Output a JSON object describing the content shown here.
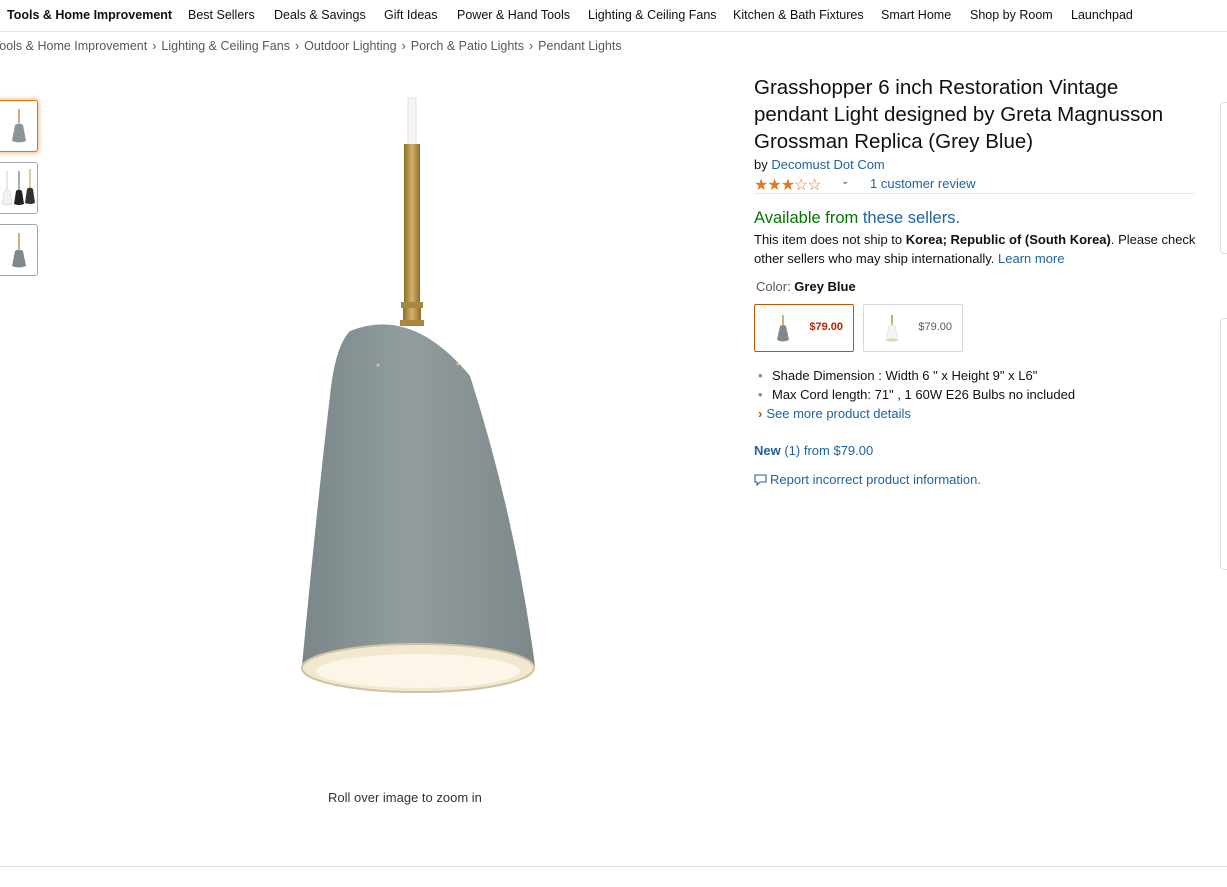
{
  "nav": {
    "items": [
      "Tools & Home Improvement",
      "Best Sellers",
      "Deals & Savings",
      "Gift Ideas",
      "Power & Hand Tools",
      "Lighting & Ceiling Fans",
      "Kitchen & Bath Fixtures",
      "Smart Home",
      "Shop by Room",
      "Launchpad"
    ]
  },
  "breadcrumb": {
    "items": [
      "Tools & Home Improvement",
      "Lighting & Ceiling Fans",
      "Outdoor Lighting",
      "Porch & Patio Lights",
      "Pendant Lights"
    ],
    "separator": "›"
  },
  "gallery": {
    "zoom_hint": "Roll over image to zoom in"
  },
  "product": {
    "title": "Grasshopper 6 inch Restoration Vintage pendant Light designed by Greta Magnusson Grossman Replica (Grey Blue)",
    "by_prefix": "by ",
    "brand": "Decomust Dot Com",
    "rating_stars": 3,
    "rating_max": 5,
    "reviews_text": "1 customer review",
    "availability_prefix": "Available from ",
    "availability_link": "these sellers.",
    "ship_text_1": "This item does not ship to ",
    "ship_country": "Korea; Republic of (South Korea)",
    "ship_text_2": ". Please check other sellers who may ship internationally. ",
    "learn_more": "Learn more",
    "color_label": "Color: ",
    "color_value": "Grey Blue",
    "swatches": [
      {
        "price": "$79.00",
        "selected": true
      },
      {
        "price": "$79.00",
        "selected": false
      }
    ],
    "bullets": [
      "Shade Dimension : Width 6 \" x Height 9\" x L6\"",
      "Max Cord length: 71\" , 1 60W E26 Bulbs no included"
    ],
    "see_more": "See more product details",
    "offers_new": "New",
    "offers_rest": " (1) from $79.00",
    "report": "Report incorrect product information."
  },
  "colors": {
    "star": "#de7921",
    "link": "#2162a1",
    "available": "#007600",
    "price_selected": "#b12704",
    "shade": "#8a9598",
    "brass": "#b8954a"
  }
}
